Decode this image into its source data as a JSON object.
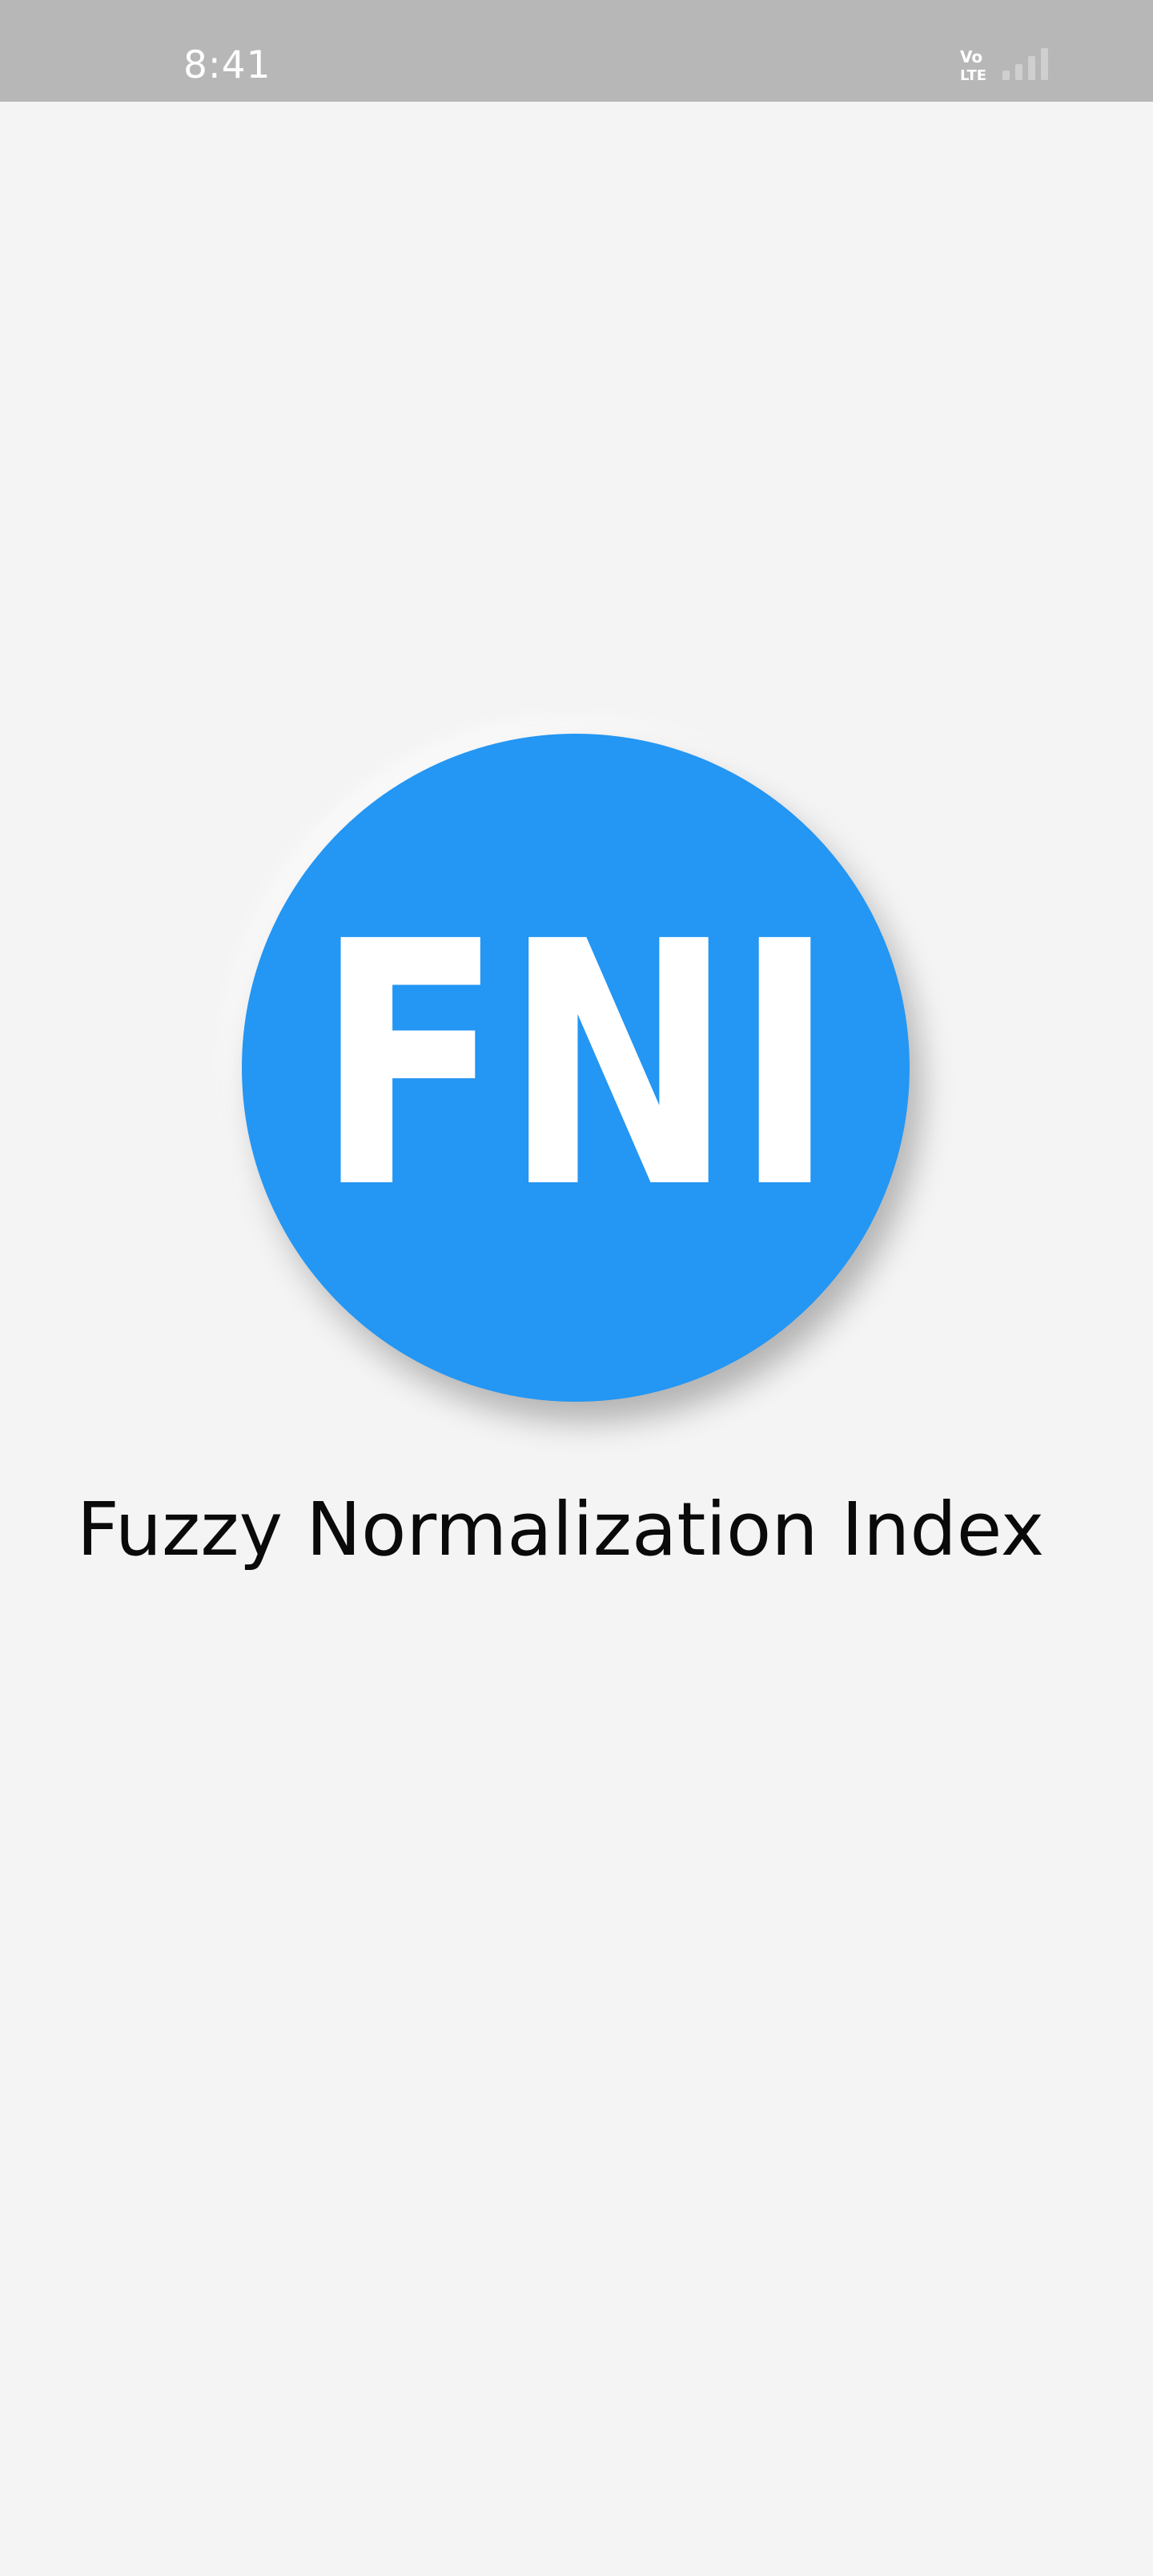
{
  "status_bar": {
    "time": "8:41",
    "network_label_top": "Vo",
    "network_label_bottom": "LTE",
    "signal_bars_filled": 0,
    "signal_bars_total": 4,
    "background": "#b7b7b7"
  },
  "splash": {
    "logo_text": "FNI",
    "logo_color": "#2496f3",
    "app_name": "Fuzzy Normalization Index",
    "background": "#f4f4f4"
  }
}
